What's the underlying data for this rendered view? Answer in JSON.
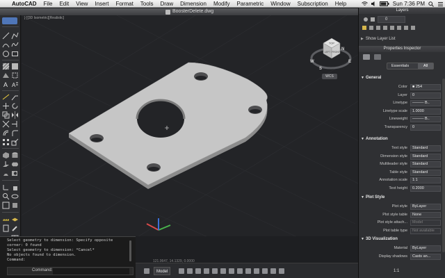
{
  "menubar": {
    "app_name": "AutoCAD",
    "items": [
      "File",
      "Edit",
      "View",
      "Insert",
      "Format",
      "Tools",
      "Draw",
      "Dimension",
      "Modify",
      "Parametric",
      "Window",
      "Subscription",
      "Help"
    ],
    "clock": "Sun 7:36 PM"
  },
  "window": {
    "document_title": "BoosterDelete.dwg"
  },
  "viewport": {
    "label": "[-][3D Isometric][Realistic]"
  },
  "viewcube": {
    "face_top": "TOP",
    "face_left": "LEFT",
    "face_right": "FRONT",
    "compass_w": "W",
    "compass_s": "S",
    "compass_n": "N",
    "compass_e": "E",
    "ucs_label": "WCS"
  },
  "command": {
    "history": "Select geometry to dimension: Specify opposite\ncorner: 0 found\nSelect geometry to dimension: *Cancel*\nNo objects found to dimension.\nCommand:",
    "prompt_label": "Command:",
    "input_value": ""
  },
  "status": {
    "model_label": "Model",
    "coords": "121.0647, 14.1329, 0.0000",
    "scale": "1:1"
  },
  "layers_panel": {
    "title": "Layers",
    "current_layer": "0",
    "show_layer_list": "Show Layer List"
  },
  "properties": {
    "title": "Properties Inspector",
    "tab_essentials": "Essentials",
    "tab_all": "All",
    "sections": {
      "general": "General",
      "annotation": "Annotation",
      "plot_style": "Plot Style",
      "visualization": "3D Visualization"
    },
    "general": [
      {
        "label": "Color",
        "value": "■ 254"
      },
      {
        "label": "Layer",
        "value": "0"
      },
      {
        "label": "Linetype",
        "value": "——— B.."
      },
      {
        "label": "Linetype scale",
        "value": "1.0000"
      },
      {
        "label": "Lineweight",
        "value": "——— B.."
      },
      {
        "label": "Transparency",
        "value": "0"
      }
    ],
    "annotation": [
      {
        "label": "Text style",
        "value": "Standard"
      },
      {
        "label": "Dimension style",
        "value": "Standard"
      },
      {
        "label": "Multileader style",
        "value": "Standard"
      },
      {
        "label": "Table style",
        "value": "Standard"
      },
      {
        "label": "Annotation scale",
        "value": "1:1"
      },
      {
        "label": "Text height",
        "value": "0.2000"
      }
    ],
    "plot_style": [
      {
        "label": "Plot style",
        "value": "ByLayer"
      },
      {
        "label": "Plot style table",
        "value": "None"
      },
      {
        "label": "Plot style attach...",
        "value": "Model"
      },
      {
        "label": "Plot table type",
        "value": "Not available"
      }
    ],
    "visualization": [
      {
        "label": "Material",
        "value": "ByLayer"
      },
      {
        "label": "Display shadows",
        "value": "Casts an..."
      }
    ]
  },
  "colors": {
    "viewport_bg": "#232427",
    "part_top": "#c6c6c6",
    "part_side": "#8c8c8c",
    "panel_bg": "#2f3033"
  }
}
